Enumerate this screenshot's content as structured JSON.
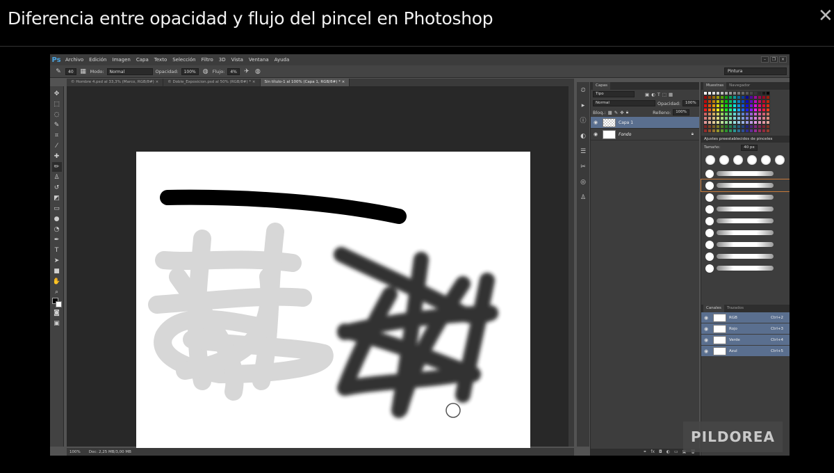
{
  "frame": {
    "title": "Diferencia entre opacidad y flujo del pincel en Photoshop",
    "close_glyph": "✕"
  },
  "app": {
    "logo": "Ps",
    "menu": [
      "Archivo",
      "Edición",
      "Imagen",
      "Capa",
      "Texto",
      "Selección",
      "Filtro",
      "3D",
      "Vista",
      "Ventana",
      "Ayuda"
    ],
    "workspace": "Pintura"
  },
  "options": {
    "brush_size": "40",
    "mode_label": "Modo:",
    "mode_value": "Normal",
    "opacity_label": "Opacidad:",
    "opacity_value": "100%",
    "flow_label": "Flujo:",
    "flow_value": "4%"
  },
  "tabs": [
    {
      "label": "© Hombre 4.psd al 33,3% (Marco, RGB/8#)  ×"
    },
    {
      "label": "© Doble_Exposicion.psd al 50% (RGB/8#) *  ×"
    },
    {
      "label": "Sin título-1 al 100% (Capa 1, RGB/8#) *  ×"
    }
  ],
  "status": {
    "zoom": "100%",
    "doc": "Doc: 2,25 MB/3,00 MB"
  },
  "layers": {
    "tab": "Capas",
    "kind_filter": "Tipo",
    "blend": "Normal",
    "opacity_label": "Opacidad:",
    "opacity_value": "100%",
    "lock_label": "Bloq.:",
    "fill_label": "Relleno:",
    "fill_value": "100%",
    "items": [
      {
        "name": "Capa 1"
      },
      {
        "name": "Fondo"
      }
    ]
  },
  "swatches": {
    "tab_active": "Muestras",
    "tab_inactive": "Navegador"
  },
  "brush_presets": {
    "title": "Ajustes preestablecidos de pinceles",
    "size_label": "Tamaño:",
    "size_value": "40 px"
  },
  "channels": {
    "tab_active": "Canales",
    "tab_inactive": "Trazados",
    "items": [
      {
        "name": "RGB",
        "shortcut": "Ctrl+2"
      },
      {
        "name": "Rojo",
        "shortcut": "Ctrl+3"
      },
      {
        "name": "Verde",
        "shortcut": "Ctrl+4"
      },
      {
        "name": "Azul",
        "shortcut": "Ctrl+5"
      }
    ]
  },
  "watermark": "PILDOREA"
}
